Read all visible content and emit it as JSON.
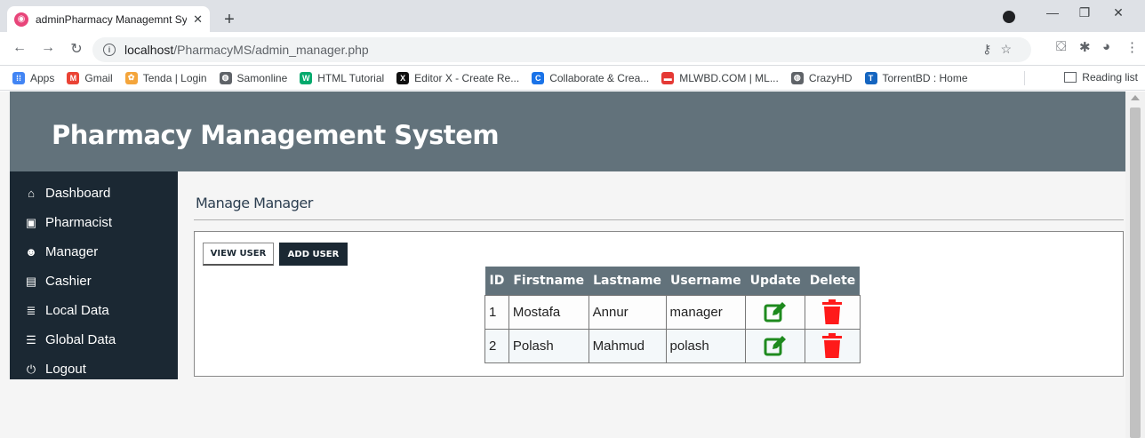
{
  "browser": {
    "tab_title": "adminPharmacy Managemnt Syst",
    "url_host": "localhost",
    "url_path": "/PharmacyMS/admin_manager.php",
    "bookmarks": [
      {
        "label": "Apps",
        "color": "#4285f4",
        "glyph": "⁞⁞"
      },
      {
        "label": "Gmail",
        "color": "#ea4335",
        "glyph": "M"
      },
      {
        "label": "Tenda | Login",
        "color": "#f4a53b",
        "glyph": "✿"
      },
      {
        "label": "Samonline",
        "color": "#5f6368",
        "glyph": "◍"
      },
      {
        "label": "HTML Tutorial",
        "color": "#04aa6d",
        "glyph": "W"
      },
      {
        "label": "Editor X - Create Re...",
        "color": "#111111",
        "glyph": "X"
      },
      {
        "label": "Collaborate & Crea...",
        "color": "#1a73e8",
        "glyph": "C"
      },
      {
        "label": "MLWBD.COM | ML...",
        "color": "#e53935",
        "glyph": "▬"
      },
      {
        "label": "CrazyHD",
        "color": "#5f6368",
        "glyph": "◍"
      },
      {
        "label": "TorrentBD : Home",
        "color": "#1565c0",
        "glyph": "T"
      }
    ],
    "reading_list": "Reading list"
  },
  "header": {
    "title": "Pharmacy Management System"
  },
  "sidebar": {
    "items": [
      {
        "label": "Dashboard",
        "icon": "home-icon",
        "glyph": "⌂"
      },
      {
        "label": "Pharmacist",
        "icon": "medkit-icon",
        "glyph": "▣"
      },
      {
        "label": "Manager",
        "icon": "user-cog-icon",
        "glyph": "☻"
      },
      {
        "label": "Cashier",
        "icon": "cash-register-icon",
        "glyph": "▤"
      },
      {
        "label": "Local Data",
        "icon": "database-icon",
        "glyph": "≣"
      },
      {
        "label": "Global Data",
        "icon": "server-icon",
        "glyph": "☰"
      },
      {
        "label": "Logout",
        "icon": "power-icon",
        "glyph": "⏻"
      }
    ]
  },
  "main": {
    "title": "Manage Manager",
    "view_user": "VIEW USER",
    "add_user": "ADD USER",
    "table": {
      "headers": [
        "ID",
        "Firstname",
        "Lastname",
        "Username",
        "Update",
        "Delete"
      ],
      "rows": [
        {
          "id": "1",
          "firstname": "Mostafa",
          "lastname": "Annur",
          "username": "manager"
        },
        {
          "id": "2",
          "firstname": "Polash",
          "lastname": "Mahmud",
          "username": "polash"
        }
      ]
    }
  },
  "colors": {
    "header_bg": "#62727b",
    "sidebar_bg": "#1b2833",
    "edit_icon": "#1e8a1e",
    "delete_icon": "#ff1a1a"
  }
}
